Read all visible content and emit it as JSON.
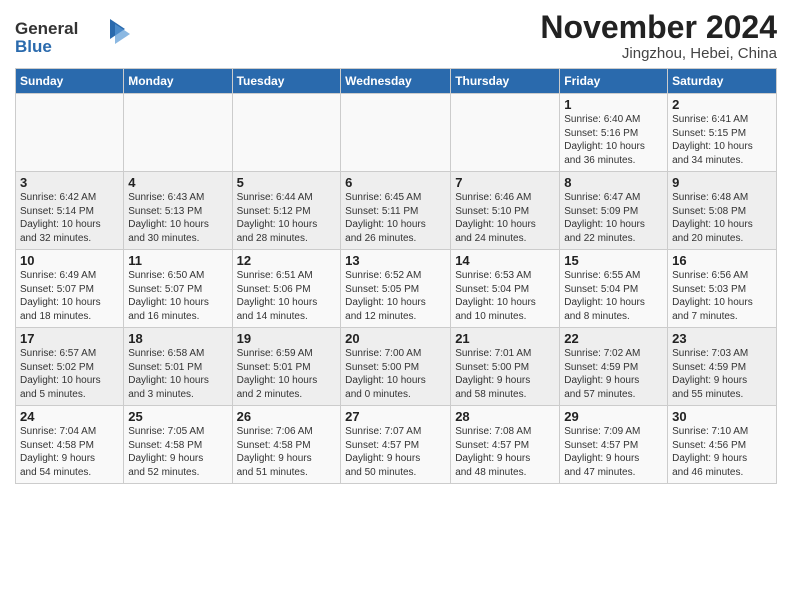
{
  "header": {
    "logo_line1": "General",
    "logo_line2": "Blue",
    "month_title": "November 2024",
    "location": "Jingzhou, Hebei, China"
  },
  "weekdays": [
    "Sunday",
    "Monday",
    "Tuesday",
    "Wednesday",
    "Thursday",
    "Friday",
    "Saturday"
  ],
  "weeks": [
    [
      {
        "day": "",
        "info": ""
      },
      {
        "day": "",
        "info": ""
      },
      {
        "day": "",
        "info": ""
      },
      {
        "day": "",
        "info": ""
      },
      {
        "day": "",
        "info": ""
      },
      {
        "day": "1",
        "info": "Sunrise: 6:40 AM\nSunset: 5:16 PM\nDaylight: 10 hours\nand 36 minutes."
      },
      {
        "day": "2",
        "info": "Sunrise: 6:41 AM\nSunset: 5:15 PM\nDaylight: 10 hours\nand 34 minutes."
      }
    ],
    [
      {
        "day": "3",
        "info": "Sunrise: 6:42 AM\nSunset: 5:14 PM\nDaylight: 10 hours\nand 32 minutes."
      },
      {
        "day": "4",
        "info": "Sunrise: 6:43 AM\nSunset: 5:13 PM\nDaylight: 10 hours\nand 30 minutes."
      },
      {
        "day": "5",
        "info": "Sunrise: 6:44 AM\nSunset: 5:12 PM\nDaylight: 10 hours\nand 28 minutes."
      },
      {
        "day": "6",
        "info": "Sunrise: 6:45 AM\nSunset: 5:11 PM\nDaylight: 10 hours\nand 26 minutes."
      },
      {
        "day": "7",
        "info": "Sunrise: 6:46 AM\nSunset: 5:10 PM\nDaylight: 10 hours\nand 24 minutes."
      },
      {
        "day": "8",
        "info": "Sunrise: 6:47 AM\nSunset: 5:09 PM\nDaylight: 10 hours\nand 22 minutes."
      },
      {
        "day": "9",
        "info": "Sunrise: 6:48 AM\nSunset: 5:08 PM\nDaylight: 10 hours\nand 20 minutes."
      }
    ],
    [
      {
        "day": "10",
        "info": "Sunrise: 6:49 AM\nSunset: 5:07 PM\nDaylight: 10 hours\nand 18 minutes."
      },
      {
        "day": "11",
        "info": "Sunrise: 6:50 AM\nSunset: 5:07 PM\nDaylight: 10 hours\nand 16 minutes."
      },
      {
        "day": "12",
        "info": "Sunrise: 6:51 AM\nSunset: 5:06 PM\nDaylight: 10 hours\nand 14 minutes."
      },
      {
        "day": "13",
        "info": "Sunrise: 6:52 AM\nSunset: 5:05 PM\nDaylight: 10 hours\nand 12 minutes."
      },
      {
        "day": "14",
        "info": "Sunrise: 6:53 AM\nSunset: 5:04 PM\nDaylight: 10 hours\nand 10 minutes."
      },
      {
        "day": "15",
        "info": "Sunrise: 6:55 AM\nSunset: 5:04 PM\nDaylight: 10 hours\nand 8 minutes."
      },
      {
        "day": "16",
        "info": "Sunrise: 6:56 AM\nSunset: 5:03 PM\nDaylight: 10 hours\nand 7 minutes."
      }
    ],
    [
      {
        "day": "17",
        "info": "Sunrise: 6:57 AM\nSunset: 5:02 PM\nDaylight: 10 hours\nand 5 minutes."
      },
      {
        "day": "18",
        "info": "Sunrise: 6:58 AM\nSunset: 5:01 PM\nDaylight: 10 hours\nand 3 minutes."
      },
      {
        "day": "19",
        "info": "Sunrise: 6:59 AM\nSunset: 5:01 PM\nDaylight: 10 hours\nand 2 minutes."
      },
      {
        "day": "20",
        "info": "Sunrise: 7:00 AM\nSunset: 5:00 PM\nDaylight: 10 hours\nand 0 minutes."
      },
      {
        "day": "21",
        "info": "Sunrise: 7:01 AM\nSunset: 5:00 PM\nDaylight: 9 hours\nand 58 minutes."
      },
      {
        "day": "22",
        "info": "Sunrise: 7:02 AM\nSunset: 4:59 PM\nDaylight: 9 hours\nand 57 minutes."
      },
      {
        "day": "23",
        "info": "Sunrise: 7:03 AM\nSunset: 4:59 PM\nDaylight: 9 hours\nand 55 minutes."
      }
    ],
    [
      {
        "day": "24",
        "info": "Sunrise: 7:04 AM\nSunset: 4:58 PM\nDaylight: 9 hours\nand 54 minutes."
      },
      {
        "day": "25",
        "info": "Sunrise: 7:05 AM\nSunset: 4:58 PM\nDaylight: 9 hours\nand 52 minutes."
      },
      {
        "day": "26",
        "info": "Sunrise: 7:06 AM\nSunset: 4:58 PM\nDaylight: 9 hours\nand 51 minutes."
      },
      {
        "day": "27",
        "info": "Sunrise: 7:07 AM\nSunset: 4:57 PM\nDaylight: 9 hours\nand 50 minutes."
      },
      {
        "day": "28",
        "info": "Sunrise: 7:08 AM\nSunset: 4:57 PM\nDaylight: 9 hours\nand 48 minutes."
      },
      {
        "day": "29",
        "info": "Sunrise: 7:09 AM\nSunset: 4:57 PM\nDaylight: 9 hours\nand 47 minutes."
      },
      {
        "day": "30",
        "info": "Sunrise: 7:10 AM\nSunset: 4:56 PM\nDaylight: 9 hours\nand 46 minutes."
      }
    ]
  ]
}
